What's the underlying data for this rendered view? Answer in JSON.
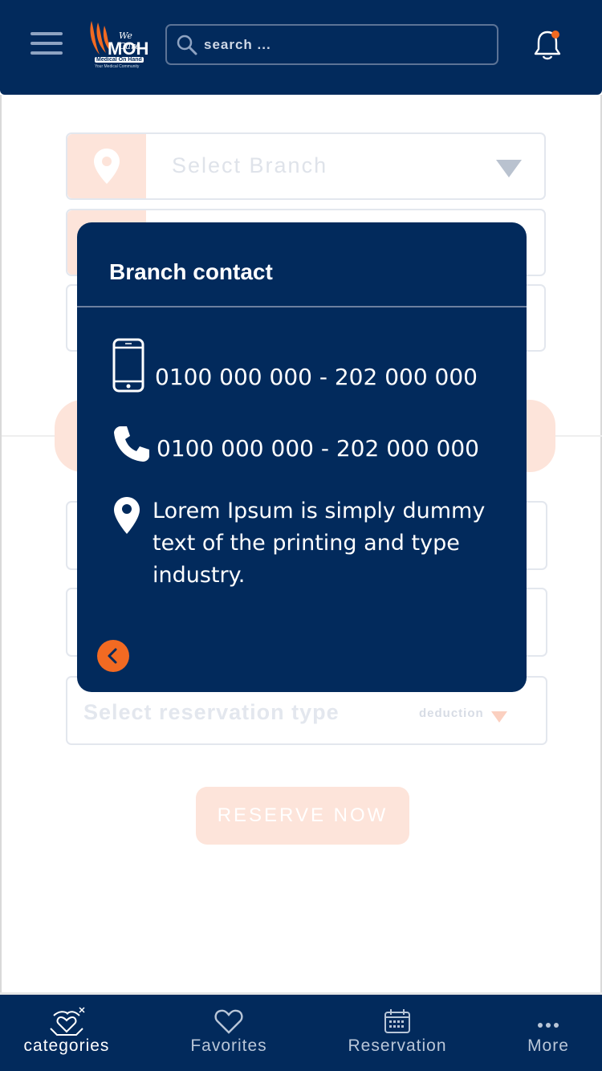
{
  "header": {
    "logo": {
      "tagline": "We Care",
      "mark": "MOH",
      "name": "Medical On Hand",
      "subtitle": "Your Medical Community"
    },
    "search_placeholder": "search ..."
  },
  "form": {
    "branch_placeholder": "Select Branch",
    "reservation_type_placeholder": "Select reservation type",
    "deduction_label": "deduction",
    "reserve_button": "RESERVE NOW"
  },
  "modal": {
    "title": "Branch contact",
    "mobile": "0100 000 000 - 202  000 000",
    "phone": "0100 000 000 - 202  000 000",
    "address": "Lorem Ipsum is simply dummy text of the printing and type industry."
  },
  "bottom_nav": [
    {
      "label": "categories",
      "icon": "categories-icon",
      "active": true
    },
    {
      "label": "Favorites",
      "icon": "heart-icon",
      "active": false
    },
    {
      "label": "Reservation",
      "icon": "calendar-icon",
      "active": false
    },
    {
      "label": "More",
      "icon": "more-dots-icon",
      "active": false
    }
  ],
  "colors": {
    "primary": "#022a5c",
    "accent": "#f26a22",
    "muted_accent": "#fde4da"
  }
}
